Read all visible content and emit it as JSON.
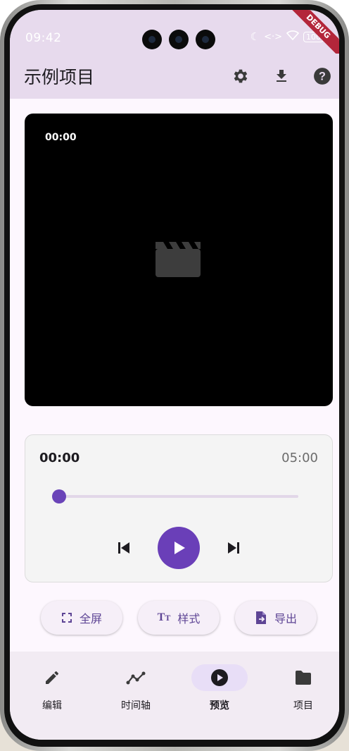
{
  "status_bar": {
    "time": "09:42",
    "battery": "100",
    "debug_banner": "DEBUG"
  },
  "app_bar": {
    "title": "示例项目",
    "actions": [
      "gear-icon",
      "download-icon",
      "help-icon"
    ]
  },
  "video": {
    "timecode": "00:00",
    "placeholder_icon": "movie-clapper-icon"
  },
  "player": {
    "current_time": "00:00",
    "total_time": "05:00",
    "progress_fraction": 0.0,
    "accent_color": "#6a3fb8"
  },
  "actions": [
    {
      "label": "全屏",
      "icon": "fullscreen-icon"
    },
    {
      "label": "样式",
      "icon": "text-style-icon"
    },
    {
      "label": "导出",
      "icon": "export-file-icon"
    }
  ],
  "nav": [
    {
      "label": "编辑",
      "icon": "pencil-icon",
      "active": false
    },
    {
      "label": "时间轴",
      "icon": "timeline-icon",
      "active": false
    },
    {
      "label": "预览",
      "icon": "play-circle-icon",
      "active": true
    },
    {
      "label": "项目",
      "icon": "folder-icon",
      "active": false
    }
  ]
}
